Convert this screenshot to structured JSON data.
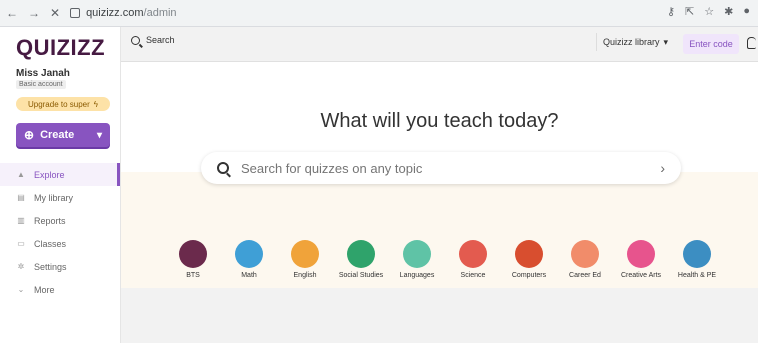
{
  "browser": {
    "url_domain": "quizizz.com",
    "url_path": "/admin"
  },
  "sidebar": {
    "logo": "QUIZIZZ",
    "user_name": "Miss Janah",
    "account_type": "Basic account",
    "upgrade_label": "Upgrade to super",
    "create_label": "Create",
    "items": [
      {
        "label": "Explore",
        "icon": "explore-icon",
        "active": true
      },
      {
        "label": "My library",
        "icon": "library-icon",
        "active": false
      },
      {
        "label": "Reports",
        "icon": "reports-icon",
        "active": false
      },
      {
        "label": "Classes",
        "icon": "classes-icon",
        "active": false
      },
      {
        "label": "Settings",
        "icon": "settings-icon",
        "active": false
      },
      {
        "label": "More",
        "icon": "chevron-down-icon",
        "active": false
      }
    ]
  },
  "topbar": {
    "search_placeholder": "Search",
    "library_selected": "Quizizz library",
    "enter_code_label": "Enter code"
  },
  "main": {
    "headline": "What will you teach today?",
    "search_placeholder": "Search for quizzes on any topic",
    "subjects": [
      {
        "label": "BTS",
        "color": "#6b2a4c"
      },
      {
        "label": "Math",
        "color": "#3f9fd6"
      },
      {
        "label": "English",
        "color": "#f0a33a"
      },
      {
        "label": "Social Studies",
        "color": "#2fa36b"
      },
      {
        "label": "Languages",
        "color": "#5fc3a6"
      },
      {
        "label": "Science",
        "color": "#e35b4f"
      },
      {
        "label": "Computers",
        "color": "#d84e2f"
      },
      {
        "label": "Career Ed",
        "color": "#f18c6a"
      },
      {
        "label": "Creative Arts",
        "color": "#e7548d"
      },
      {
        "label": "Health & PE",
        "color": "#3c8ec2"
      }
    ]
  },
  "colors": {
    "brand": "#8854c0",
    "logo": "#461a42",
    "upgrade_bg": "#fde2a7"
  }
}
